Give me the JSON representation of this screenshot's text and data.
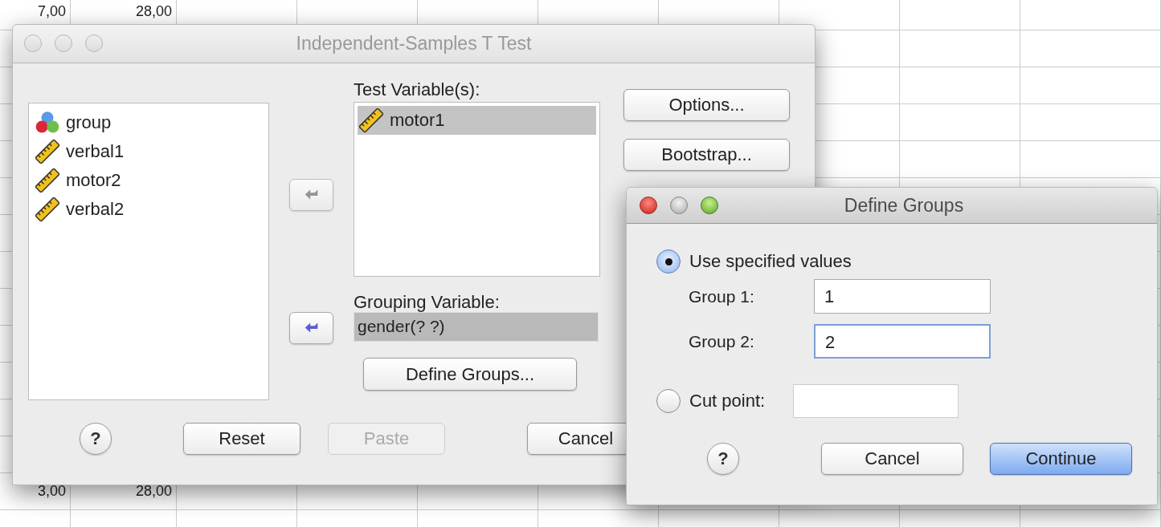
{
  "spreadsheet": {
    "rows": [
      {
        "cells": [
          "7,00",
          "28,00"
        ]
      },
      {
        "cells": [
          "3,00",
          "28,00"
        ]
      }
    ]
  },
  "main_window": {
    "title": "Independent-Samples T Test",
    "active": false,
    "source_list": [
      {
        "name": "group",
        "kind": "nominal",
        "selected": false
      },
      {
        "name": "verbal1",
        "kind": "scale",
        "selected": false
      },
      {
        "name": "motor2",
        "kind": "scale",
        "selected": false
      },
      {
        "name": "verbal2",
        "kind": "scale",
        "selected": false
      }
    ],
    "move_buttons": [
      {
        "disabled": true
      },
      {
        "disabled": false
      }
    ],
    "test_variables": {
      "label": "Test Variable(s):",
      "items": [
        {
          "name": "motor1",
          "kind": "scale",
          "selected": true
        }
      ]
    },
    "grouping_variable": {
      "label": "Grouping Variable:",
      "value": "gender(? ?)"
    },
    "define_groups_button": "Define Groups...",
    "side_buttons": [
      "Options...",
      "Bootstrap..."
    ],
    "bottom_buttons": [
      {
        "label": "?",
        "kind": "help"
      },
      {
        "label": "Reset",
        "kind": "push",
        "disabled": false
      },
      {
        "label": "Paste",
        "kind": "push",
        "disabled": true
      },
      {
        "label": "Cancel",
        "kind": "push",
        "disabled": false
      }
    ]
  },
  "dialog": {
    "title": "Define Groups",
    "active": true,
    "options": [
      {
        "label": "Use specified values",
        "selected": true,
        "fields": [
          {
            "label": "Group 1:",
            "value": "1",
            "focused": false
          },
          {
            "label": "Group 2:",
            "value": "2",
            "focused": true
          }
        ]
      },
      {
        "label": "Cut point:",
        "selected": false
      }
    ],
    "buttons": [
      {
        "label": "?",
        "kind": "help"
      },
      {
        "label": "Cancel",
        "kind": "push",
        "default": false
      },
      {
        "label": "Continue",
        "kind": "push",
        "default": true
      }
    ]
  }
}
